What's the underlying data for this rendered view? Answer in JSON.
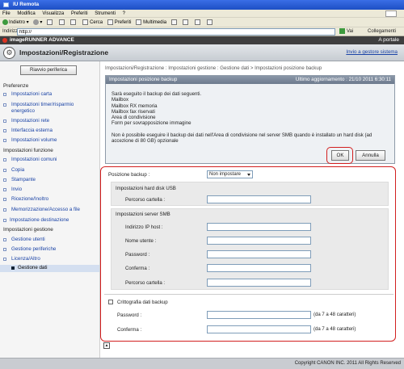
{
  "window": {
    "title": "IU Remota"
  },
  "menubar": [
    "File",
    "Modifica",
    "Visualizza",
    "Preferiti",
    "Strumenti",
    "?"
  ],
  "toolbar": {
    "back": "Indietro",
    "search": "Cerca",
    "favorites": "Preferiti",
    "multimedia": "Multimedia"
  },
  "address": {
    "label": "Indirizzo",
    "value": "http://",
    "go": "Vai",
    "links": "Collegamenti"
  },
  "brand": {
    "name": "imageRUNNER ADVANCE",
    "portal": "A portale"
  },
  "header": {
    "title": "Impostazioni/Registrazione",
    "system_manager": "Invio a gestore sistema"
  },
  "sidebar": {
    "restart": "Riavvio periferica",
    "sections": {
      "preferences": "Preferenze",
      "function_settings": "Impostazioni funzione",
      "management": "Impostazioni gestione"
    },
    "preferences_items": [
      "Impostazioni carta",
      "Impostazioni timer/risparmio",
      "energetico",
      "Impostazioni rete",
      "Interfaccia esterna",
      "Impostazioni volume"
    ],
    "function_items": [
      "Impostazioni comuni",
      "Copia",
      "Stampante",
      "Invio",
      "Ricezione/Inoltro",
      "Memorizzazione/Accesso a file"
    ],
    "destination": "Impostazione destinazione",
    "management_items": [
      "Gestione utenti",
      "Gestione periferiche",
      "Licenza/Altro",
      "Gestione dati"
    ]
  },
  "breadcrumb": "Impostazioni/Registrazione : Impostazioni gestione : Gestione dati > Impostazioni posizione backup",
  "panel": {
    "title": "Impostazioni posizione backup",
    "updated": "Ultimo aggiornamento : 21/10 2011 6:30:11",
    "lines": [
      "Sarà eseguito il backup dei dati seguenti.",
      "Mailbox",
      "Mailbox RX memoria",
      "Mailbox fax riservati",
      "Area di condivisione",
      "Form per sovrapposizione immagine"
    ],
    "note_line1": "Non è possibile eseguire il backup dei dati nell'Area di condivisione nel server SMB quando è installato un hard disk (ad",
    "note_line2": "accezione di 80 GB) opzionale",
    "ok": "OK",
    "cancel": "Annulla"
  },
  "form": {
    "backup_position_label": "Posizione backup :",
    "backup_position_value": "Non impostare",
    "usb_title": "Impostazioni hard disk USB",
    "usb_folder_label": "Percorso cartella :",
    "smb_title": "Impostazioni server SMB",
    "ip_label": "Indirizzo IP host :",
    "user_label": "Nome utente :",
    "password_label": "Password :",
    "confirm_label": "Conferma :",
    "smb_folder_label": "Percorso cartella :",
    "encrypt_label": "Crittografia dati backup",
    "enc_password_label": "Password :",
    "enc_confirm_label": "Conferma :",
    "hint": "(da 7 a 48 caratteri)"
  },
  "footer": {
    "copyright": "Copyright CANON INC. 2011 All Rights Reserved"
  }
}
